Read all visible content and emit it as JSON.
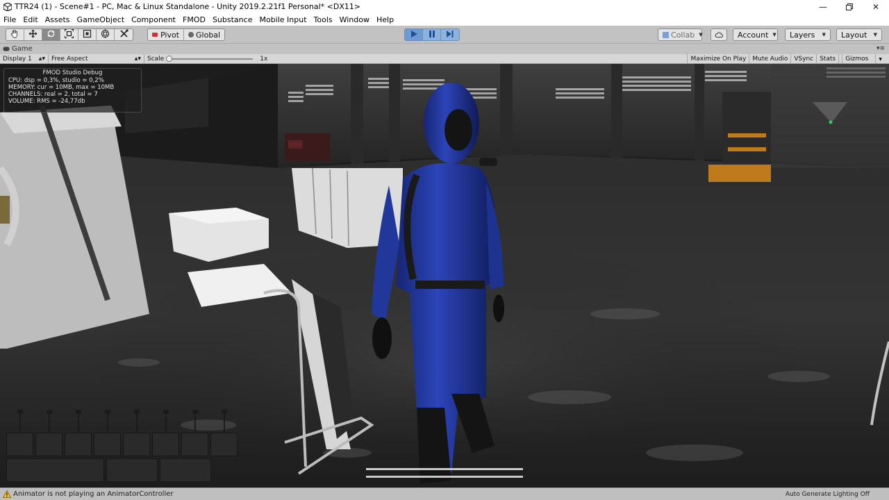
{
  "window": {
    "title": "TTR24 (1) - Scene#1 - PC, Mac & Linux Standalone - Unity 2019.2.21f1 Personal* <DX11>"
  },
  "menu": [
    "File",
    "Edit",
    "Assets",
    "GameObject",
    "Component",
    "FMOD",
    "Substance",
    "Mobile Input",
    "Tools",
    "Window",
    "Help"
  ],
  "toolbar": {
    "pivot_label": "Pivot",
    "global_label": "Global",
    "collab_label": "Collab",
    "account_label": "Account",
    "layers_label": "Layers",
    "layout_label": "Layout"
  },
  "game_tab": {
    "label": "Game"
  },
  "game_bar": {
    "display": "Display 1",
    "aspect": "Free Aspect",
    "scale_label": "Scale",
    "scale_value": "1x",
    "maximize": "Maximize On Play",
    "mute": "Mute Audio",
    "vsync": "VSync",
    "stats": "Stats",
    "gizmos": "Gizmos"
  },
  "fmod_debug": {
    "title": "FMOD Studio Debug",
    "cpu": "CPU: dsp = 0,3%, studio = 0,2%",
    "memory": "MEMORY: cur = 10MB, max = 10MB",
    "channels": "CHANNELS: real = 2, total = 7",
    "volume": "VOLUME: RMS = -24,77db"
  },
  "status": {
    "message": "Animator is not playing an AnimatorController",
    "right": "Auto Generate Lighting Off"
  },
  "colors": {
    "play_active": "#6c9bd2",
    "suit_blue": "#1c2f8f"
  },
  "icons": {
    "tools": [
      "hand-icon",
      "move-icon",
      "rotate-icon",
      "scale-icon",
      "rect-icon",
      "transform-icon",
      "custom-tool-icon"
    ]
  }
}
